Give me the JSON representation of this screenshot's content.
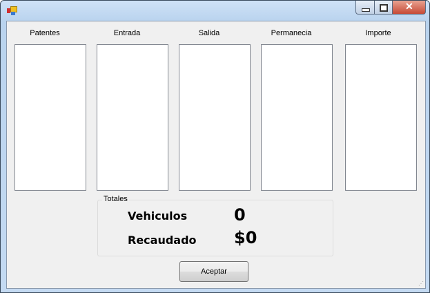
{
  "window": {
    "title": "",
    "controls": {
      "minimize": "minimize",
      "maximize": "maximize",
      "close": "close"
    }
  },
  "columns": [
    {
      "label": "Patentes"
    },
    {
      "label": "Entrada"
    },
    {
      "label": "Salida"
    },
    {
      "label": "Permanecia"
    },
    {
      "label": "Importe"
    }
  ],
  "totales": {
    "title": "Totales",
    "vehiculos_label": "Vehiculos",
    "vehiculos_value": "0",
    "recaudado_label": "Recaudado",
    "recaudado_value": "$0"
  },
  "buttons": {
    "aceptar": "Aceptar"
  }
}
